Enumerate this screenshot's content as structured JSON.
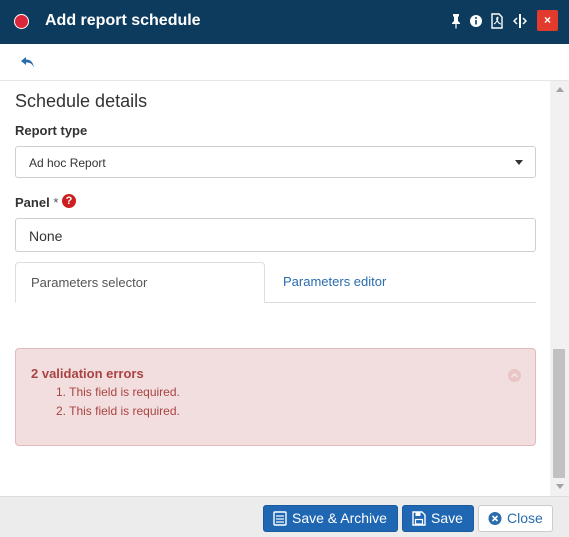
{
  "window": {
    "title": "Add report schedule",
    "close_label": "×",
    "accent_color": "#0d3b5e"
  },
  "form": {
    "section_title": "Schedule details",
    "report_type": {
      "label": "Report type",
      "value": "Ad hoc Report"
    },
    "panel": {
      "label": "Panel",
      "required_marker": "*",
      "value": "None",
      "help_icon": "question-circle-icon"
    }
  },
  "tabs": [
    {
      "label": "Parameters selector",
      "active": true
    },
    {
      "label": "Parameters editor",
      "active": false
    }
  ],
  "validation": {
    "title": "2 validation errors",
    "errors": [
      "1. This field is required.",
      "2. This field is required."
    ]
  },
  "footer": {
    "save_archive_label": "Save & Archive",
    "save_label": "Save",
    "close_label": "Close"
  },
  "icons": {
    "titlebar": [
      "pin-icon",
      "info-icon",
      "pdf-icon",
      "resize-icon",
      "close-icon"
    ],
    "toolbar": [
      "back-icon"
    ]
  }
}
